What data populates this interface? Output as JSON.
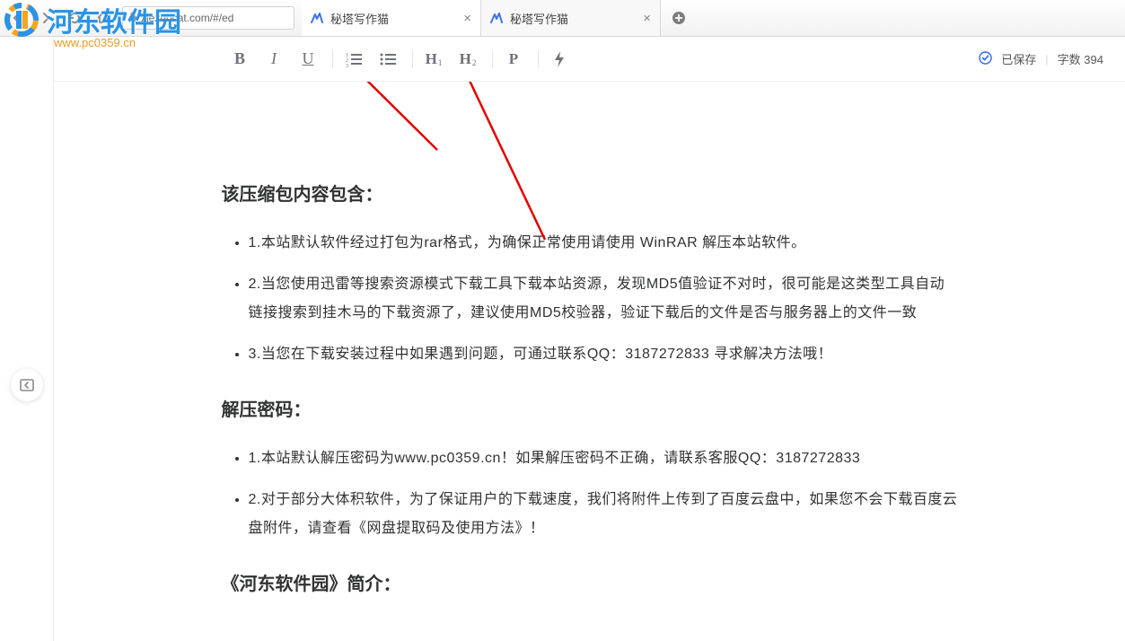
{
  "browser": {
    "url": "xiezuocat.com/#/ed",
    "tabs": [
      {
        "title": "秘塔写作猫",
        "active": true
      },
      {
        "title": "秘塔写作猫",
        "active": false
      }
    ]
  },
  "watermark": {
    "text": "河东软件园",
    "url": "www.pc0359.cn"
  },
  "toolbar": {
    "status_saved": "已保存",
    "word_count_label": "字数",
    "word_count_value": "394"
  },
  "document": {
    "section1_title": "该压缩包内容包含：",
    "section1_items": [
      "1.本站默认软件经过打包为rar格式，为确保正常使用请使用 WinRAR 解压本站软件。",
      "2.当您使用迅雷等搜索资源模式下载工具下载本站资源，发现MD5值验证不对时，很可能是这类型工具自动链接搜索到挂木马的下载资源了，建议使用MD5校验器，验证下载后的文件是否与服务器上的文件一致",
      "3.当您在下载安装过程中如果遇到问题，可通过联系QQ：3187272833 寻求解决方法哦！"
    ],
    "section2_title": "解压密码：",
    "section2_items": [
      "1.本站默认解压密码为www.pc0359.cn！如果解压密码不正确，请联系客服QQ：3187272833",
      "2.对于部分大体积软件，为了保证用户的下载速度，我们将附件上传到了百度云盘中，如果您不会下载百度云盘附件，请查看《网盘提取码及使用方法》！"
    ],
    "section3_title": "《河东软件园》简介："
  }
}
